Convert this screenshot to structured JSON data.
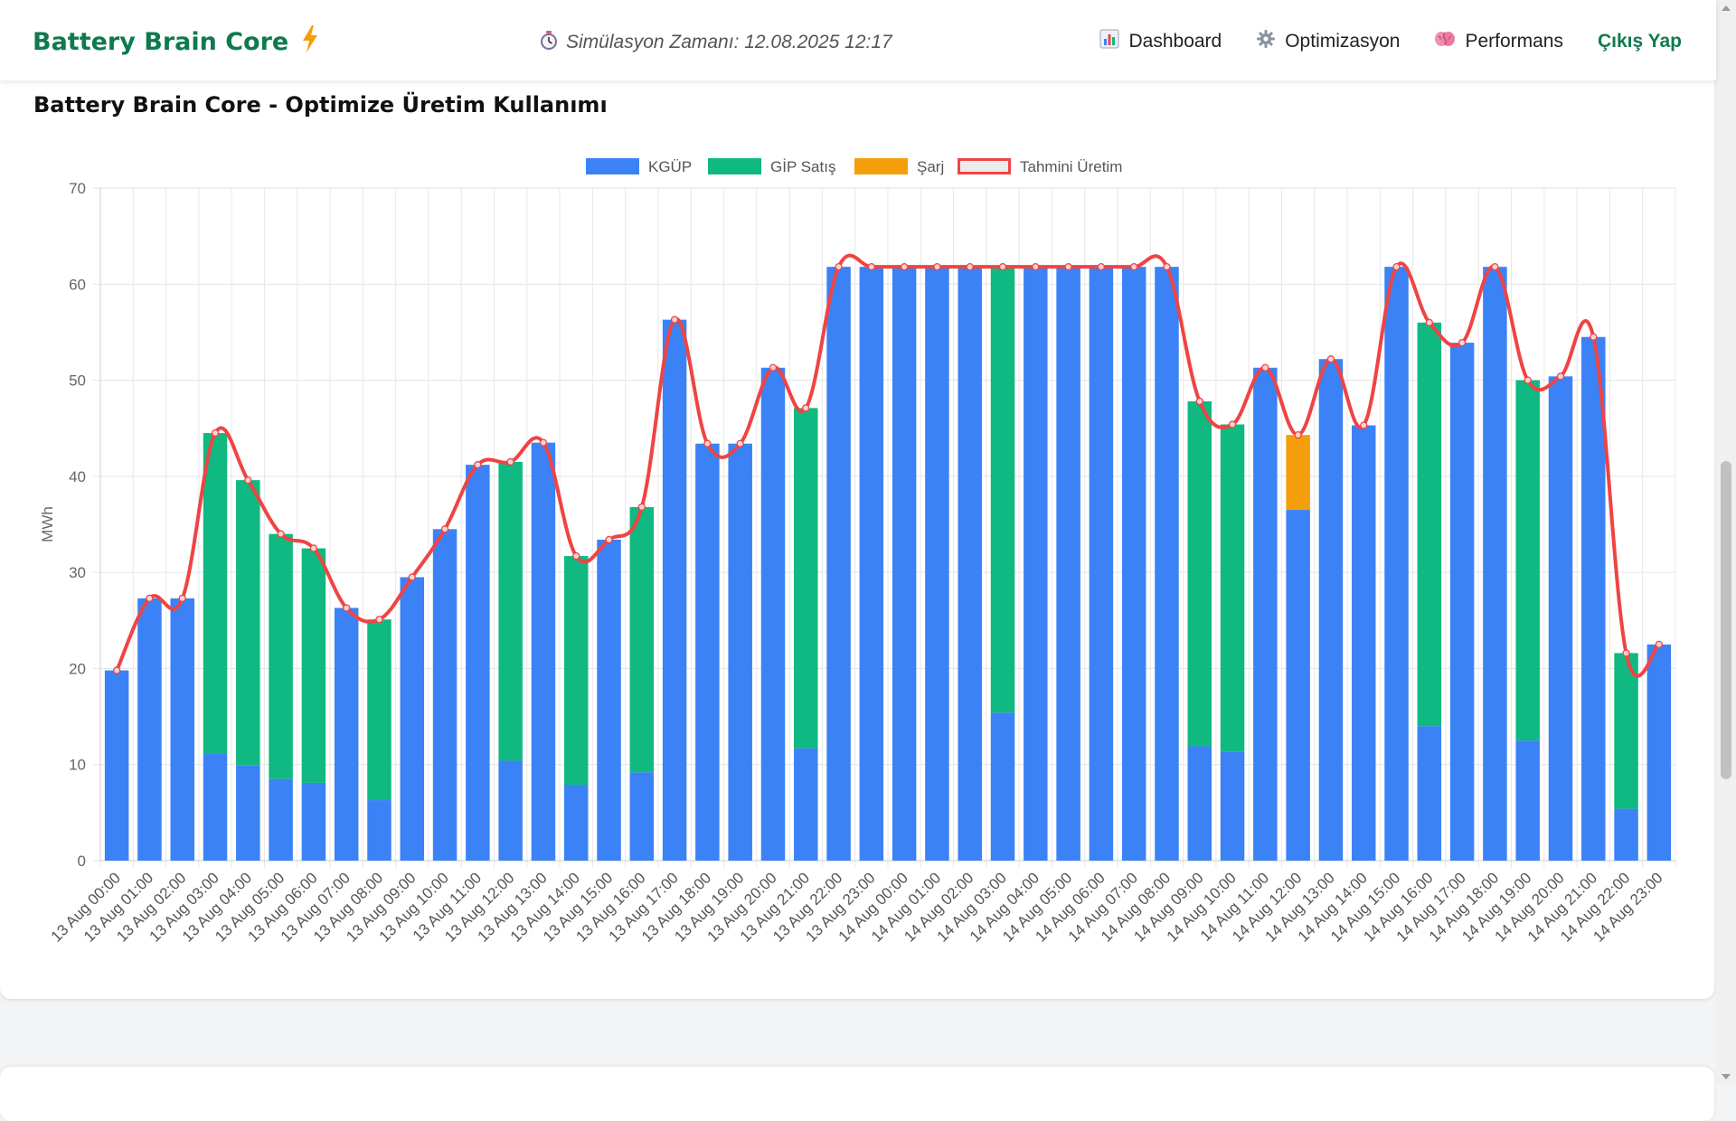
{
  "header": {
    "brand": "Battery Brain Core",
    "brand_icon": "lightning-icon",
    "sim_time": "Simülasyon Zamanı: 12.08.2025 12:17",
    "sim_icon": "stopwatch-icon",
    "nav": [
      {
        "label": "Dashboard",
        "icon": "bar-chart-icon"
      },
      {
        "label": "Optimizasyon",
        "icon": "gear-icon"
      },
      {
        "label": "Performans",
        "icon": "brain-icon"
      }
    ],
    "logout": "Çıkış Yap"
  },
  "colors": {
    "brand": "#0f7a4f",
    "kgup": "#3b82f6",
    "gip": "#10b981",
    "sarj": "#f59e0b",
    "forecast": "#ef4444"
  },
  "card": {
    "title": "Battery Brain Core - Optimize Üretim Kullanımı"
  },
  "chart_data": {
    "type": "bar",
    "stacked": true,
    "title": "",
    "ylabel": "MWh",
    "xlabel": "",
    "ylim": [
      0,
      70
    ],
    "yticks": [
      0,
      10,
      20,
      30,
      40,
      50,
      60,
      70
    ],
    "legend_position": "top",
    "grid": true,
    "categories": [
      "13 Aug 00:00",
      "13 Aug 01:00",
      "13 Aug 02:00",
      "13 Aug 03:00",
      "13 Aug 04:00",
      "13 Aug 05:00",
      "13 Aug 06:00",
      "13 Aug 07:00",
      "13 Aug 08:00",
      "13 Aug 09:00",
      "13 Aug 10:00",
      "13 Aug 11:00",
      "13 Aug 12:00",
      "13 Aug 13:00",
      "13 Aug 14:00",
      "13 Aug 15:00",
      "13 Aug 16:00",
      "13 Aug 17:00",
      "13 Aug 18:00",
      "13 Aug 19:00",
      "13 Aug 20:00",
      "13 Aug 21:00",
      "13 Aug 22:00",
      "13 Aug 23:00",
      "14 Aug 00:00",
      "14 Aug 01:00",
      "14 Aug 02:00",
      "14 Aug 03:00",
      "14 Aug 04:00",
      "14 Aug 05:00",
      "14 Aug 06:00",
      "14 Aug 07:00",
      "14 Aug 08:00",
      "14 Aug 09:00",
      "14 Aug 10:00",
      "14 Aug 11:00",
      "14 Aug 12:00",
      "14 Aug 13:00",
      "14 Aug 14:00",
      "14 Aug 15:00",
      "14 Aug 16:00",
      "14 Aug 17:00",
      "14 Aug 18:00",
      "14 Aug 19:00",
      "14 Aug 20:00",
      "14 Aug 21:00",
      "14 Aug 22:00",
      "14 Aug 23:00"
    ],
    "series": [
      {
        "name": "KGÜP",
        "color": "#3b82f6",
        "values": [
          19.8,
          27.3,
          27.3,
          11.1,
          9.9,
          8.5,
          8.1,
          26.3,
          6.3,
          29.5,
          34.5,
          41.2,
          10.4,
          43.5,
          7.9,
          33.4,
          9.2,
          56.3,
          43.4,
          43.4,
          51.3,
          11.7,
          61.8,
          61.8,
          61.8,
          61.8,
          61.8,
          15.4,
          61.8,
          61.8,
          61.8,
          61.8,
          61.8,
          11.9,
          11.3,
          51.3,
          36.5,
          52.2,
          45.3,
          61.8,
          14.0,
          53.9,
          61.8,
          12.5,
          50.4,
          54.5,
          5.4,
          22.5
        ]
      },
      {
        "name": "GİP Satış",
        "color": "#10b981",
        "values": [
          0,
          0,
          0,
          33.4,
          29.7,
          25.5,
          24.4,
          0,
          18.8,
          0,
          0,
          0,
          31.1,
          0,
          23.8,
          0,
          27.6,
          0,
          0,
          0,
          0,
          35.4,
          0,
          0,
          0,
          0,
          0,
          46.4,
          0,
          0,
          0,
          0,
          0,
          35.9,
          34.1,
          0,
          0,
          0,
          0,
          0,
          42.0,
          0,
          0,
          37.5,
          0,
          0,
          16.2,
          0
        ]
      },
      {
        "name": "Şarj",
        "color": "#f59e0b",
        "values": [
          0,
          0,
          0,
          0,
          0,
          0,
          0,
          0,
          0,
          0,
          0,
          0,
          0,
          0,
          0,
          0,
          0,
          0,
          0,
          0,
          0,
          0,
          0,
          0,
          0,
          0,
          0,
          0,
          0,
          0,
          0,
          0,
          0,
          0,
          0,
          0,
          7.8,
          0,
          0,
          0,
          0,
          0,
          0,
          0,
          0,
          0,
          0,
          0
        ]
      }
    ],
    "line": {
      "name": "Tahmini Üretim",
      "color": "#ef4444",
      "values": [
        19.8,
        27.3,
        27.3,
        44.5,
        39.6,
        34.0,
        32.5,
        26.3,
        25.1,
        29.5,
        34.5,
        41.2,
        41.5,
        43.5,
        31.7,
        33.4,
        36.8,
        56.3,
        43.4,
        43.4,
        51.3,
        47.1,
        61.8,
        61.8,
        61.8,
        61.8,
        61.8,
        61.8,
        61.8,
        61.8,
        61.8,
        61.8,
        61.8,
        47.8,
        45.4,
        51.3,
        44.3,
        52.2,
        45.3,
        61.8,
        56.0,
        53.9,
        61.8,
        50.0,
        50.4,
        54.5,
        21.6,
        22.5
      ]
    }
  }
}
